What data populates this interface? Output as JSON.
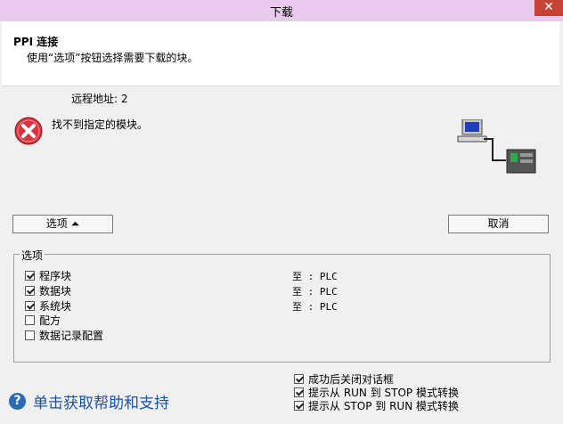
{
  "window": {
    "title": "下载",
    "close_label": "✕"
  },
  "header": {
    "title": "PPI 连接",
    "description": "使用“选项”按钮选择需要下载的块。"
  },
  "remote_address": "远程地址: 2",
  "error": {
    "message": "找不到指定的模块。"
  },
  "buttons": {
    "options_label": "选项 ⏶",
    "cancel_label": "取消"
  },
  "options_group": {
    "legend": "选项",
    "blocks": [
      {
        "label": "程序块",
        "checked": true,
        "destination": "至 : PLC"
      },
      {
        "label": "数据块",
        "checked": true,
        "destination": "至 : PLC"
      },
      {
        "label": "系统块",
        "checked": true,
        "destination": "至 : PLC"
      },
      {
        "label": "配方",
        "checked": false,
        "destination": ""
      },
      {
        "label": "数据记录配置",
        "checked": false,
        "destination": ""
      }
    ]
  },
  "settings": [
    {
      "label": "成功后关闭对话框",
      "checked": true
    },
    {
      "label": "提示从 RUN 到 STOP 模式转换",
      "checked": true
    },
    {
      "label": "提示从 STOP 到 RUN 模式转换",
      "checked": true
    }
  ],
  "help": {
    "text": "单击获取帮助和支持",
    "icon": "?"
  },
  "icons": {
    "error": "error-x-icon",
    "network": "pc-to-plc-icon",
    "help": "help-icon"
  },
  "colors": {
    "titlebar": "#e9c9ee",
    "close": "#c74338",
    "error": "#d9333f",
    "help_link": "#1a52a8"
  }
}
